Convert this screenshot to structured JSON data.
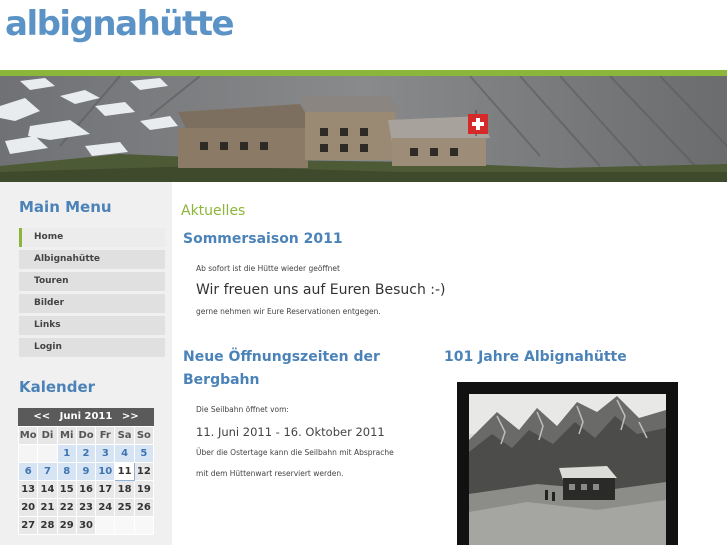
{
  "site": {
    "logo": "albignahütte"
  },
  "sidebar": {
    "menu_heading": "Main Menu",
    "menu": [
      {
        "label": "Home",
        "active": true
      },
      {
        "label": "Albignahütte",
        "active": false
      },
      {
        "label": "Touren",
        "active": false
      },
      {
        "label": "Bilder",
        "active": false
      },
      {
        "label": "Links",
        "active": false
      },
      {
        "label": "Login",
        "active": false
      }
    ],
    "calendar_heading": "Kalender",
    "calendar": {
      "prev": "<<",
      "month": "Juni 2011",
      "next": ">>",
      "weekdays": [
        "Mo",
        "Di",
        "Mi",
        "Do",
        "Fr",
        "Sa",
        "So"
      ],
      "weeks": [
        [
          "",
          "",
          "1",
          "2",
          "3",
          "4",
          "5"
        ],
        [
          "6",
          "7",
          "8",
          "9",
          "10",
          "11",
          "12"
        ],
        [
          "13",
          "14",
          "15",
          "16",
          "17",
          "18",
          "19"
        ],
        [
          "20",
          "21",
          "22",
          "23",
          "24",
          "25",
          "26"
        ],
        [
          "27",
          "28",
          "29",
          "30",
          "",
          "",
          ""
        ]
      ]
    }
  },
  "main": {
    "section_title": "Aktuelles",
    "article1": {
      "title": "Sommersaison 2011",
      "line1": "Ab sofort ist die Hütte wieder geöffnet",
      "line2": "Wir freuen uns auf Euren Besuch :-)",
      "line3": "gerne nehmen wir Eure Reservationen entgegen."
    },
    "article2": {
      "title_line1": "Neue Öffnungszeiten der",
      "title_line2": "Bergbahn",
      "line1": "Die Seilbahn öffnet vom:",
      "line2": "11. Juni 2011 - 16. Oktober 2011",
      "line3": "Über die Ostertage kann die Seilbahn mit Absprache",
      "line4": "mit dem Hüttenwart reserviert werden."
    },
    "article3": {
      "title": "101 Jahre Albignahütte"
    }
  },
  "colors": {
    "accent_green": "#8cb63a",
    "heading_blue": "#4b83b8",
    "logo_blue": "#5b93c7"
  }
}
